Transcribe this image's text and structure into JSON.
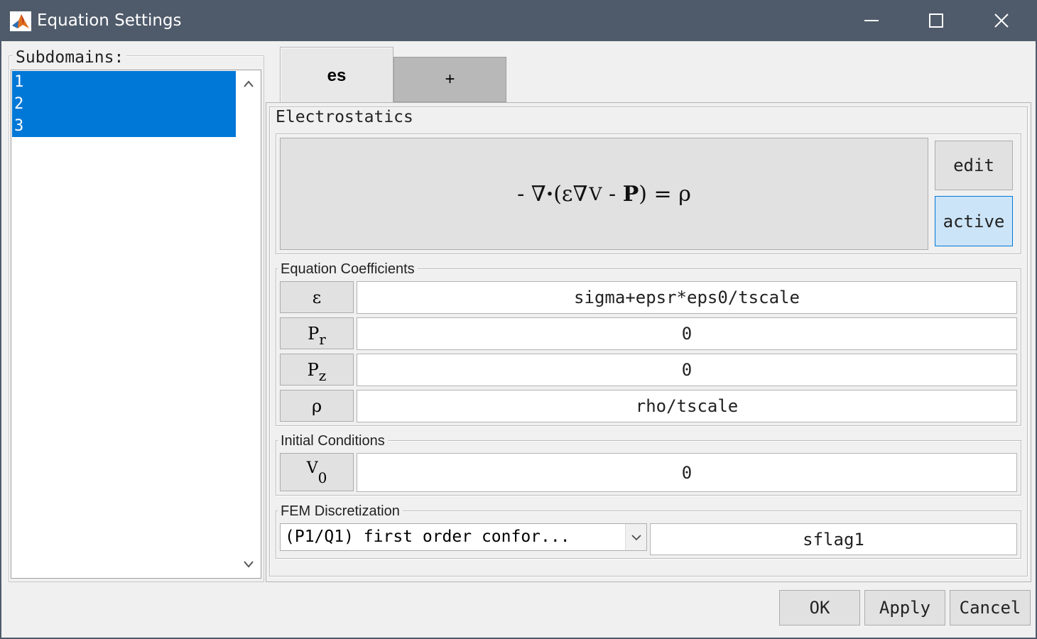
{
  "window": {
    "title": "Equation Settings"
  },
  "subdomains": {
    "label": "Subdomains:",
    "items": [
      "1",
      "2",
      "3"
    ]
  },
  "tabs": [
    {
      "label": "es",
      "selected": true
    },
    {
      "label": "+",
      "selected": false
    }
  ],
  "equation_panel": {
    "title": "Electrostatics",
    "equation": {
      "minus": "-",
      "nabla1": "∇",
      "dot": "·",
      "open": "(",
      "eps": "ε",
      "nabla2": "∇",
      "v": "V",
      "minus2": "-",
      "p": "P",
      "close": ")",
      "eq": "=",
      "rho": "ρ"
    },
    "edit_label": "edit",
    "active_label": "active"
  },
  "coefficients": {
    "title": "Equation Coefficients",
    "rows": [
      {
        "symbol": "ε",
        "sub": "",
        "value": "sigma+epsr*eps0/tscale"
      },
      {
        "symbol": "P",
        "sub": "r",
        "value": "0"
      },
      {
        "symbol": "P",
        "sub": "z",
        "value": "0"
      },
      {
        "symbol": "ρ",
        "sub": "",
        "value": "rho/tscale"
      }
    ]
  },
  "initial_conditions": {
    "title": "Initial Conditions",
    "symbol": "V",
    "sub": "0",
    "value": "0"
  },
  "fem": {
    "title": "FEM Discretization",
    "selected": "(P1/Q1) first order confor...",
    "flag": "sflag1"
  },
  "buttons": {
    "ok": "OK",
    "apply": "Apply",
    "cancel": "Cancel"
  },
  "colors": {
    "titlebar": "#4f5b6b",
    "selection": "#0078d7",
    "active_toggle": "#cce4f7"
  }
}
